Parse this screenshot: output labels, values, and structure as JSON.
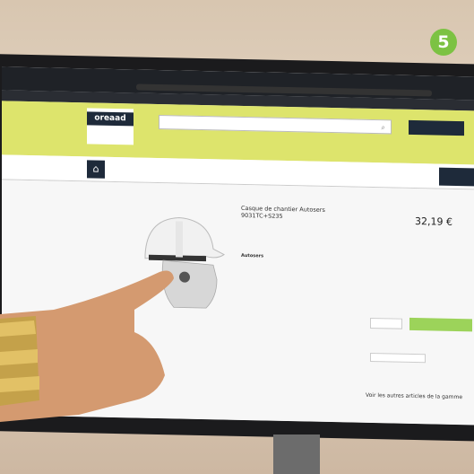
{
  "badge": {
    "number": "5"
  },
  "browser": {
    "tabs": [
      "",
      ""
    ]
  },
  "site": {
    "logo": "oreaad",
    "logo_sub": "",
    "search_placeholder": "",
    "account_label": "",
    "nav_items": [
      "",
      "",
      "",
      "",
      "",
      "",
      "",
      "",
      "",
      ""
    ],
    "nav_cta": ""
  },
  "product": {
    "back_link": "",
    "title": "Casque de chantier Autosers 9031TC+S235",
    "ref": "",
    "price": "32,19 €",
    "add_to_cart": "",
    "availability": "",
    "brand": "Autosers",
    "see_more_range": "Voir les autres articles de la gamme"
  },
  "cookie": {
    "text": "",
    "button": ""
  },
  "colors": {
    "accent": "#dde46c",
    "navy": "#1e2a3a",
    "green_button": "#9cd35a",
    "badge": "#7cc243"
  }
}
